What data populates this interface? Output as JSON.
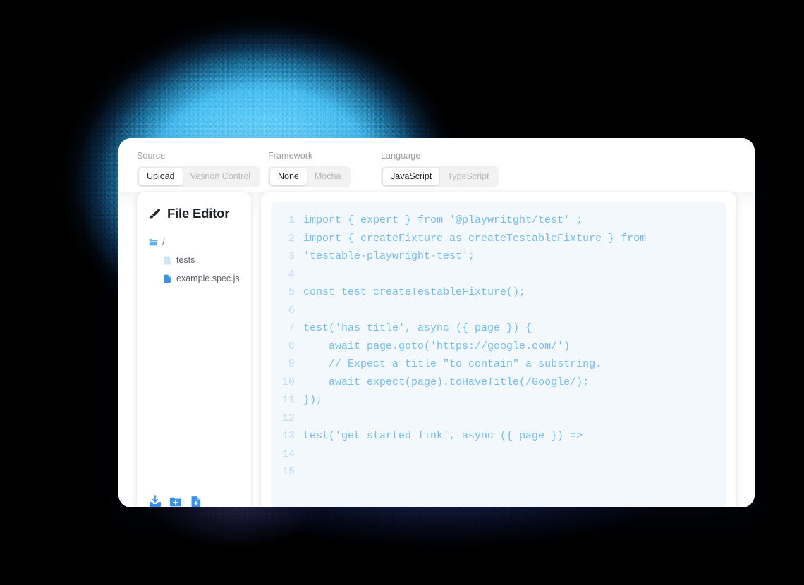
{
  "toolbar": {
    "groups": [
      {
        "label": "Source",
        "options": [
          {
            "label": "Upload",
            "selected": true
          },
          {
            "label": "Vesrion Control",
            "selected": false
          }
        ]
      },
      {
        "label": "Framework",
        "options": [
          {
            "label": "None",
            "selected": true
          },
          {
            "label": "Mocha",
            "selected": false
          }
        ]
      },
      {
        "label": "Language",
        "options": [
          {
            "label": "JavaScript",
            "selected": true
          },
          {
            "label": "TypeScript",
            "selected": false
          }
        ]
      }
    ]
  },
  "sidebar": {
    "title": "File Editor",
    "title_icon": "brush-icon",
    "tree": [
      {
        "label": "/",
        "icon": "folder-open-icon",
        "depth": 0
      },
      {
        "label": "tests",
        "icon": "file-icon-muted",
        "depth": 1
      },
      {
        "label": "example.spec.js",
        "icon": "file-icon-active",
        "depth": 1
      }
    ],
    "actions": [
      {
        "name": "import-file-icon",
        "title": "Import"
      },
      {
        "name": "new-folder-icon",
        "title": "New folder"
      },
      {
        "name": "new-file-icon",
        "title": "New file"
      }
    ]
  },
  "editor": {
    "line_numbers": [
      "1",
      "2",
      "3",
      "4",
      "5",
      "6",
      "7",
      "8",
      "9",
      "10",
      "11",
      "12",
      "13",
      "14",
      "15"
    ],
    "code_lines": [
      "import { expert } from '@playwritght/test' ;",
      "import { createFixture as createTestableFixture } from 'testable-playwright-test';",
      "",
      "const test createTestableFixture();",
      "",
      "test('has title', async ({ page }) {",
      "    await page.goto('https://google.com/')",
      "    // Expect a title \"to contain\" a substring.",
      "    await expect(page).toHaveTitle(/Google/);",
      "});",
      "",
      "test('get started link', async ({ page }) =>",
      "",
      "",
      ""
    ]
  },
  "colors": {
    "accent_blue": "#3b93e8",
    "code_text": "#74bdf2",
    "gutter_text": "#bcdcf5",
    "code_bg": "#f3f8fd",
    "glow_cyan": "#62cdf8",
    "glow_navy": "#26356b",
    "page_bg": "#000000",
    "card_bg": "#ffffff"
  }
}
